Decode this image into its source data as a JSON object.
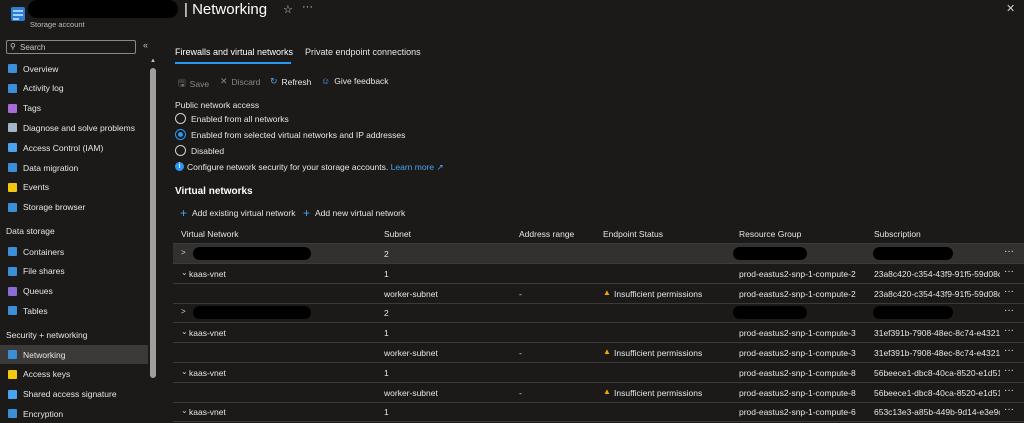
{
  "header": {
    "title": "| Networking",
    "subtitle": "Storage account",
    "colors": {
      "accent": "#2899f5",
      "warning": "#f7a500",
      "logo": "#2f7dd1"
    }
  },
  "sidebar": {
    "search_placeholder": "Search",
    "items_top": [
      {
        "label": "Overview",
        "icon": "overview-icon",
        "color": "#3b8fd9"
      },
      {
        "label": "Activity log",
        "icon": "activity-log-icon",
        "color": "#3b8fd9"
      },
      {
        "label": "Tags",
        "icon": "tags-icon",
        "color": "#a56bd6"
      },
      {
        "label": "Diagnose and solve problems",
        "icon": "wrench-icon",
        "color": "#9fb5c8"
      },
      {
        "label": "Access Control (IAM)",
        "icon": "iam-icon",
        "color": "#4aa3f0"
      },
      {
        "label": "Data migration",
        "icon": "data-migration-icon",
        "color": "#3b8fd9"
      },
      {
        "label": "Events",
        "icon": "lightning-icon",
        "color": "#f2c811"
      },
      {
        "label": "Storage browser",
        "icon": "storage-browser-icon",
        "color": "#3b8fd9"
      }
    ],
    "section_data_storage": "Data storage",
    "items_data_storage": [
      {
        "label": "Containers",
        "icon": "containers-icon",
        "color": "#3b8fd9"
      },
      {
        "label": "File shares",
        "icon": "file-shares-icon",
        "color": "#3b8fd9"
      },
      {
        "label": "Queues",
        "icon": "queues-icon",
        "color": "#8c6ad8"
      },
      {
        "label": "Tables",
        "icon": "tables-icon",
        "color": "#3b8fd9"
      }
    ],
    "section_security": "Security + networking",
    "items_security": [
      {
        "label": "Networking",
        "icon": "networking-icon",
        "color": "#3b8fd9"
      },
      {
        "label": "Access keys",
        "icon": "key-icon",
        "color": "#f2c811"
      },
      {
        "label": "Shared access signature",
        "icon": "link-icon",
        "color": "#4aa3f0"
      },
      {
        "label": "Encryption",
        "icon": "lock-icon",
        "color": "#3b8fd9"
      }
    ]
  },
  "tabs": [
    "Firewalls and virtual networks",
    "Private endpoint connections"
  ],
  "toolbar": {
    "save": "Save",
    "discard": "Discard",
    "refresh": "Refresh",
    "feedback": "Give feedback"
  },
  "public_access": {
    "label": "Public network access",
    "options": [
      "Enabled from all networks",
      "Enabled from selected virtual networks and IP addresses",
      "Disabled"
    ],
    "info_text": "Configure network security for your storage accounts.",
    "learn_more": "Learn more"
  },
  "vnets": {
    "heading": "Virtual networks",
    "add_existing": "Add existing virtual network",
    "add_new": "Add new virtual network",
    "columns": [
      "Virtual Network",
      "Subnet",
      "Address range",
      "Endpoint Status",
      "Resource Group",
      "Subscription"
    ],
    "rows": [
      {
        "vnet": "",
        "subnet": "2",
        "range": "",
        "status": "",
        "rg": "",
        "sub": ""
      },
      {
        "vnet": "kaas-vnet",
        "subnet": "1",
        "range": "",
        "status": "",
        "rg": "prod-eastus2-snp-1-compute-2",
        "sub": "23a8c420-c354-43f9-91f5-59d08c..."
      },
      {
        "vnet": "",
        "subnet": "worker-subnet",
        "range": "-",
        "status": "Insufficient permissions",
        "rg": "prod-eastus2-snp-1-compute-2",
        "sub": "23a8c420-c354-43f9-91f5-59d08c..."
      },
      {
        "vnet": "",
        "subnet": "2",
        "range": "",
        "status": "",
        "rg": "",
        "sub": ""
      },
      {
        "vnet": "kaas-vnet",
        "subnet": "1",
        "range": "",
        "status": "",
        "rg": "prod-eastus2-snp-1-compute-3",
        "sub": "31ef391b-7908-48ec-8c74-e43211..."
      },
      {
        "vnet": "",
        "subnet": "worker-subnet",
        "range": "-",
        "status": "Insufficient permissions",
        "rg": "prod-eastus2-snp-1-compute-3",
        "sub": "31ef391b-7908-48ec-8c74-e43211..."
      },
      {
        "vnet": "kaas-vnet",
        "subnet": "1",
        "range": "",
        "status": "",
        "rg": "prod-eastus2-snp-1-compute-8",
        "sub": "56beece1-dbc8-40ca-8520-e1d51..."
      },
      {
        "vnet": "",
        "subnet": "worker-subnet",
        "range": "-",
        "status": "Insufficient permissions",
        "rg": "prod-eastus2-snp-1-compute-8",
        "sub": "56beece1-dbc8-40ca-8520-e1d51..."
      },
      {
        "vnet": "kaas-vnet",
        "subnet": "1",
        "range": "",
        "status": "",
        "rg": "prod-eastus2-snp-1-compute-6",
        "sub": "653c13e3-a85b-449b-9d14-e3e9c..."
      }
    ]
  }
}
